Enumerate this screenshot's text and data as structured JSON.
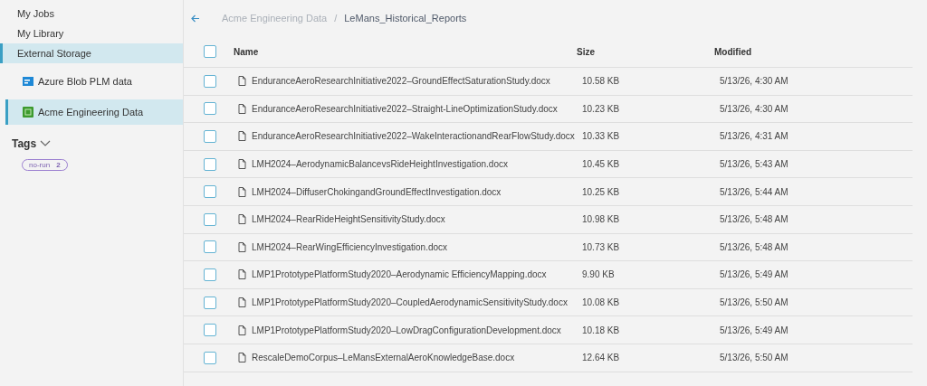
{
  "sidebar": {
    "items": [
      {
        "label": "My Jobs",
        "selected": false,
        "kind": "top"
      },
      {
        "label": "My Library",
        "selected": false,
        "kind": "top"
      },
      {
        "label": "External Storage",
        "selected": true,
        "kind": "top"
      },
      {
        "label": "Azure Blob PLM data",
        "selected": false,
        "kind": "azure"
      },
      {
        "label": "Acme Engineering Data",
        "selected": true,
        "kind": "acme"
      }
    ],
    "tags": {
      "title": "Tags",
      "expanded": true,
      "items": [
        {
          "label": "no-run",
          "count": "2"
        }
      ]
    }
  },
  "breadcrumb": {
    "separator": "/",
    "items": [
      "Acme Engineering Data",
      "LeMans_Historical_Reports"
    ]
  },
  "table": {
    "select_all": {
      "checked": false
    },
    "columns": [
      "Name",
      "Size",
      "Modified"
    ],
    "rows": [
      {
        "name": "EnduranceAeroResearchInitiative2022–GroundEffectSaturationStudy.docx",
        "size": "10.58 KB",
        "modified": "5/13/26, 4:30 AM",
        "checked": false
      },
      {
        "name": "EnduranceAeroResearchInitiative2022–Straight-LineOptimizationStudy.docx",
        "size": "10.23 KB",
        "modified": "5/13/26, 4:30 AM",
        "checked": false
      },
      {
        "name": "EnduranceAeroResearchInitiative2022–WakeInteractionandRearFlowStudy.docx",
        "size": "10.33 KB",
        "modified": "5/13/26, 4:31 AM",
        "checked": false
      },
      {
        "name": "LMH2024–AerodynamicBalancevsRideHeightInvestigation.docx",
        "size": "10.45 KB",
        "modified": "5/13/26, 5:43 AM",
        "checked": false
      },
      {
        "name": "LMH2024–DiffuserChokingandGroundEffectInvestigation.docx",
        "size": "10.25 KB",
        "modified": "5/13/26, 5:44 AM",
        "checked": false
      },
      {
        "name": "LMH2024–RearRideHeightSensitivityStudy.docx",
        "size": "10.98 KB",
        "modified": "5/13/26, 5:48 AM",
        "checked": false
      },
      {
        "name": "LMH2024–RearWingEfficiencyInvestigation.docx",
        "size": "10.73 KB",
        "modified": "5/13/26, 5:48 AM",
        "checked": false
      },
      {
        "name": "LMP1PrototypePlatformStudy2020–Aerodynamic EfficiencyMapping.docx",
        "size": "9.90 KB",
        "modified": "5/13/26, 5:49 AM",
        "checked": false
      },
      {
        "name": "LMP1PrototypePlatformStudy2020–CoupledAerodynamicSensitivityStudy.docx",
        "size": "10.08 KB",
        "modified": "5/13/26, 5:50 AM",
        "checked": false
      },
      {
        "name": "LMP1PrototypePlatformStudy2020–LowDragConfigurationDevelopment.docx",
        "size": "10.18 KB",
        "modified": "5/13/26, 5:49 AM",
        "checked": false
      },
      {
        "name": "RescaleDemoCorpus–LeMansExternalAeroKnowledgeBase.docx",
        "size": "12.64 KB",
        "modified": "5/13/26, 5:50 AM",
        "checked": false
      }
    ]
  }
}
